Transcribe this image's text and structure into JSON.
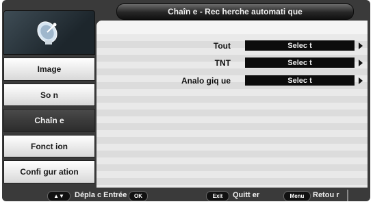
{
  "header": {
    "title": "Chaîn e - Rec herche automati que"
  },
  "sidebar": {
    "logo_icon": "satellite-dish-icon",
    "items": [
      {
        "label": "Image",
        "active": false
      },
      {
        "label": "So n",
        "active": false
      },
      {
        "label": "Chaîn e",
        "active": true
      },
      {
        "label": "Fonct ion",
        "active": false
      },
      {
        "label": "Confi gur ation",
        "active": false
      }
    ]
  },
  "content": {
    "rows": [
      {
        "label": "Tout",
        "value": "Selec t"
      },
      {
        "label": "TNT",
        "value": "Selec t"
      },
      {
        "label": "Analo giq ue",
        "value": "Selec t"
      }
    ]
  },
  "footer": {
    "nav_key": "▲▼",
    "nav_text": "Dépla c Entrée",
    "ok_key": "OK",
    "exit_key": "Exit",
    "exit_text": "Quitt er",
    "menu_key": "Menu",
    "menu_text": "Retou r"
  },
  "colors": {
    "frame": "#3a3a3a",
    "active_item": "#2c2c2c",
    "value_box": "#0c0c0c"
  }
}
